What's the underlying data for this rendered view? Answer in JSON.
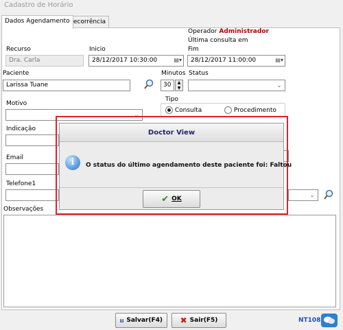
{
  "window": {
    "title": "Cadastro de Horário"
  },
  "tabs": [
    {
      "label": "Dados Agendamento"
    },
    {
      "label": "Recorrência"
    }
  ],
  "operator": {
    "label": "Operador",
    "name": "Administrador",
    "last_consult_label": "Última consulta em"
  },
  "form": {
    "recurso_label": "Recurso",
    "recurso_value": "Dra. Carla",
    "inicio_label": "Inicio",
    "inicio_value": "28/12/2017 10:30:00",
    "fim_label": "Fim",
    "fim_value": "28/12/2017 11:00:00",
    "paciente_label": "Paciente",
    "paciente_value": "Larissa Tuane",
    "minutos_label": "Minutos",
    "minutos_value": "30",
    "status_label": "Status",
    "status_value": "",
    "motivo_label": "Motivo",
    "tipo_label": "Tipo",
    "tipo_options": [
      "Consulta",
      "Procedimento"
    ],
    "indicacao_label": "Indicação",
    "email_label": "Email",
    "telefone_label": "Telefone1",
    "observacoes_label": "Observações"
  },
  "dialog": {
    "title": "Doctor View",
    "message": "O status do último agendamento deste paciente foi:  Faltou",
    "ok_label": "OK"
  },
  "footer": {
    "save_label": "Salvar(F4)",
    "exit_label": "Sair(F5)",
    "version": "NT108"
  },
  "icons": {
    "search": "search-icon",
    "info": "info-icon",
    "calendar": "calendar-icon",
    "chat": "chat-icon"
  },
  "colors": {
    "operator_name": "#b00000",
    "highlight_border": "#e02027",
    "dialog_title": "#23236a",
    "version_text": "#1f4fa8"
  }
}
